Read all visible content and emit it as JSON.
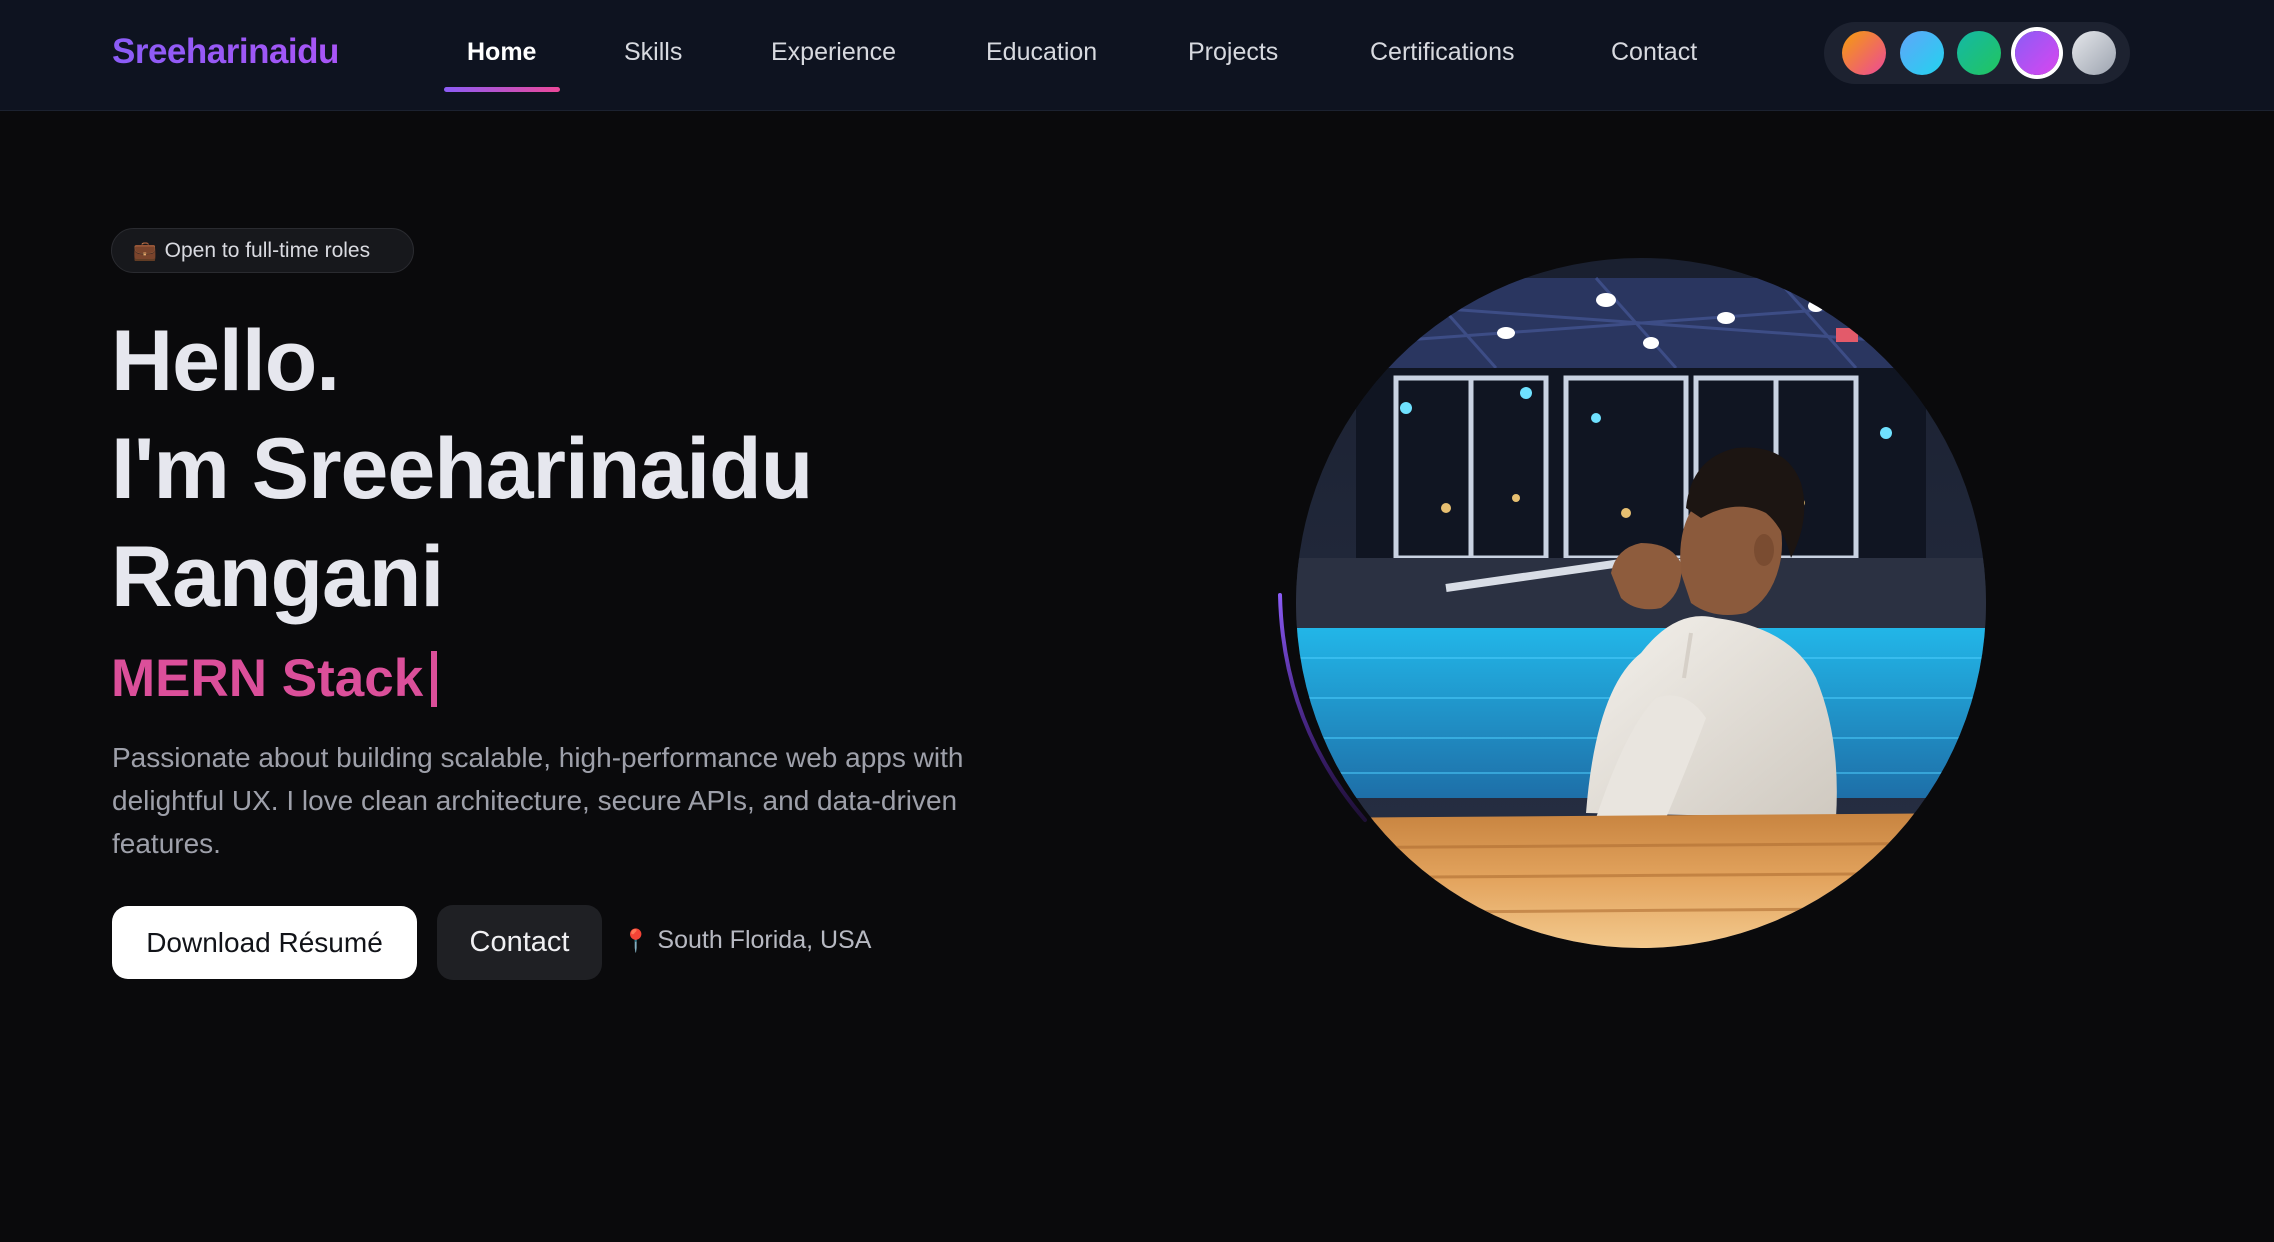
{
  "brand": "Sreeharinaidu",
  "nav": {
    "items": [
      {
        "label": "Home",
        "active": true
      },
      {
        "label": "Skills",
        "active": false
      },
      {
        "label": "Experience",
        "active": false
      },
      {
        "label": "Education",
        "active": false
      },
      {
        "label": "Projects",
        "active": false
      },
      {
        "label": "Certifications",
        "active": false
      },
      {
        "label": "Contact",
        "active": false
      }
    ]
  },
  "theme_swatches": [
    {
      "name": "sunset",
      "colors": [
        "#f59e0b",
        "#ec4899"
      ],
      "selected": false
    },
    {
      "name": "sky",
      "colors": [
        "#60a5fa",
        "#22d3ee"
      ],
      "selected": false
    },
    {
      "name": "emerald",
      "colors": [
        "#14b8a6",
        "#22c55e"
      ],
      "selected": false
    },
    {
      "name": "violet",
      "colors": [
        "#8b5cf6",
        "#d946ef"
      ],
      "selected": true
    },
    {
      "name": "silver",
      "colors": [
        "#e5e7eb",
        "#9ca3af"
      ],
      "selected": false
    }
  ],
  "hero": {
    "badge_icon": "briefcase-icon",
    "badge": "Open to full-time roles",
    "greeting": "Hello.",
    "name_line1": "I'm Sreeharinaidu",
    "name_line2": "Rangani",
    "role": "MERN Stack",
    "description": "Passionate about building scalable, high-performance web apps with delightful UX. I love clean architecture, secure APIs, and data-driven features.",
    "primary_button": "Download Résumé",
    "secondary_button": "Contact",
    "location_icon": "pin-icon",
    "location": "South Florida, USA"
  },
  "colors": {
    "accent_purple": "#8b5cf6",
    "accent_pink": "#db4f9a",
    "background": "#0a0a0c",
    "nav_background": "#0e1320"
  }
}
